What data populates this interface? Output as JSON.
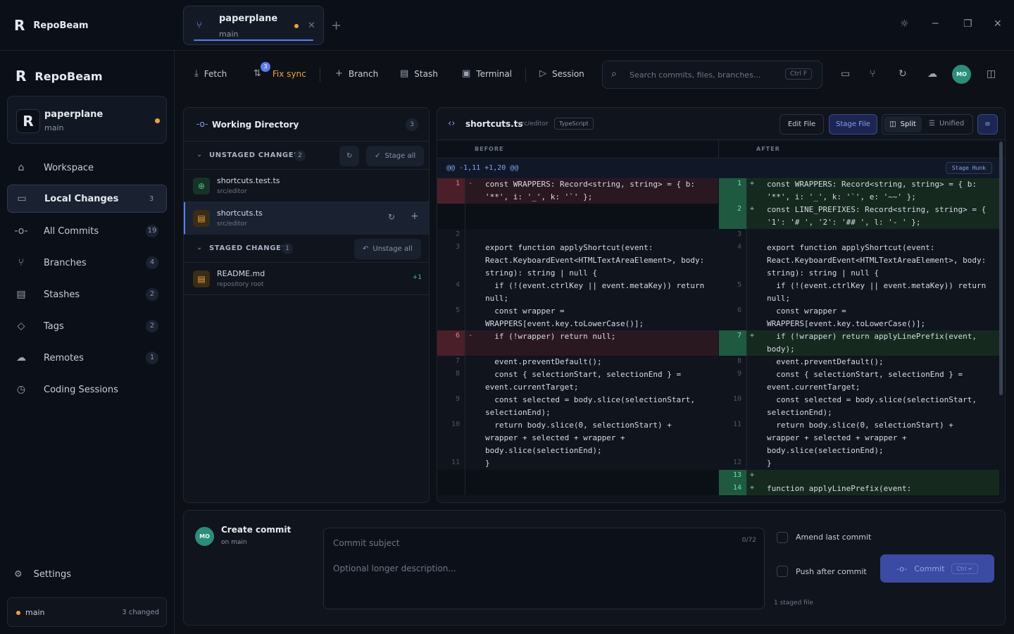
{
  "titlebar": {
    "app_name": "RepoBeam",
    "tab_title": "paperplane",
    "tab_branch": "main"
  },
  "sidebar": {
    "brand": "RepoBeam",
    "repo": {
      "name": "paperplane",
      "branch": "main"
    },
    "items": [
      {
        "label": "Workspace",
        "count": "",
        "icon": "home-icon"
      },
      {
        "label": "Local Changes",
        "count": "3",
        "icon": "inbox-icon"
      },
      {
        "label": "All Commits",
        "count": "19",
        "icon": "commit-icon"
      },
      {
        "label": "Branches",
        "count": "4",
        "icon": "branch-icon"
      },
      {
        "label": "Stashes",
        "count": "2",
        "icon": "archive-icon"
      },
      {
        "label": "Tags",
        "count": "2",
        "icon": "tag-icon"
      },
      {
        "label": "Remotes",
        "count": "1",
        "icon": "cloud-icon"
      },
      {
        "label": "Coding Sessions",
        "count": "",
        "icon": "clock-icon"
      }
    ],
    "settings": "Settings",
    "status": {
      "branch": "main",
      "changed": "3 changed"
    }
  },
  "toolbar": {
    "fetch": "Fetch",
    "fix_sync": "Fix sync",
    "fix_sync_badge": "3",
    "branch": "Branch",
    "stash": "Stash",
    "terminal": "Terminal",
    "session": "Session",
    "search_placeholder": "Search commits, files, branches...",
    "search_kbd": "Ctrl F",
    "avatar": "MO"
  },
  "working_directory": {
    "title": "Working Directory",
    "count": "3",
    "unstaged": {
      "label": "UNSTAGED CHANGES",
      "count": "2",
      "action": "Stage all",
      "files": [
        {
          "name": "shortcuts.test.ts",
          "path": "src/editor"
        },
        {
          "name": "shortcuts.ts",
          "path": "src/editor"
        }
      ]
    },
    "staged": {
      "label": "STAGED CHANGES",
      "count": "1",
      "action": "Unstage all",
      "files": [
        {
          "name": "README.md",
          "path": "repository root",
          "delta": "+1"
        }
      ]
    }
  },
  "diff": {
    "file": "shortcuts.ts",
    "path": "src/editor",
    "lang": "TypeScript",
    "edit": "Edit File",
    "stage": "Stage File",
    "split": "Split",
    "unified": "Unified",
    "before": "BEFORE",
    "after": "AFTER",
    "hunk": "@@ -1,11 +1,20 @@",
    "stage_hunk": "Stage Hunk",
    "left": [
      {
        "n": "1",
        "m": "-",
        "kind": "del",
        "lines": [
          "const WRAPPERS: Record<string, string> = { b:",
          "'**', i: '_', k: '`' };"
        ]
      },
      {
        "n": "",
        "m": "",
        "kind": "empty",
        "lines": [
          "",
          ""
        ]
      },
      {
        "n": "2",
        "m": "",
        "kind": "ctx",
        "lines": [
          ""
        ]
      },
      {
        "n": "3",
        "m": "",
        "kind": "ctx",
        "lines": [
          "export function applyShortcut(event:",
          "React.KeyboardEvent<HTMLTextAreaElement>, body:",
          "string): string | null {"
        ]
      },
      {
        "n": "4",
        "m": "",
        "kind": "ctx",
        "lines": [
          "  if (!(event.ctrlKey || event.metaKey)) return",
          "null;"
        ]
      },
      {
        "n": "5",
        "m": "",
        "kind": "ctx",
        "lines": [
          "  const wrapper =",
          "WRAPPERS[event.key.toLowerCase()];"
        ]
      },
      {
        "n": "6",
        "m": "-",
        "kind": "del",
        "lines": [
          "  if (!wrapper) return null;",
          ""
        ]
      },
      {
        "n": "7",
        "m": "",
        "kind": "ctx",
        "lines": [
          "  event.preventDefault();"
        ]
      },
      {
        "n": "8",
        "m": "",
        "kind": "ctx",
        "lines": [
          "  const { selectionStart, selectionEnd } =",
          "event.currentTarget;"
        ]
      },
      {
        "n": "9",
        "m": "",
        "kind": "ctx",
        "lines": [
          "  const selected = body.slice(selectionStart,",
          "selectionEnd);"
        ]
      },
      {
        "n": "10",
        "m": "",
        "kind": "ctx",
        "lines": [
          "  return body.slice(0, selectionStart) +",
          "wrapper + selected + wrapper +",
          "body.slice(selectionEnd);"
        ]
      },
      {
        "n": "11",
        "m": "",
        "kind": "ctx",
        "lines": [
          "}"
        ]
      },
      {
        "n": "",
        "m": "",
        "kind": "empty",
        "lines": [
          ""
        ]
      },
      {
        "n": "",
        "m": "",
        "kind": "empty",
        "lines": [
          ""
        ]
      }
    ],
    "right": [
      {
        "n": "1",
        "m": "+",
        "kind": "add",
        "lines": [
          "const WRAPPERS: Record<string, string> = { b:",
          "'**', i: '_', k: '`', e: '~~' };"
        ]
      },
      {
        "n": "2",
        "m": "+",
        "kind": "add",
        "lines": [
          "const LINE_PREFIXES: Record<string, string> = {",
          "'1': '# ', '2': '## ', l: '- ' };"
        ]
      },
      {
        "n": "3",
        "m": "",
        "kind": "ctx",
        "lines": [
          ""
        ]
      },
      {
        "n": "4",
        "m": "",
        "kind": "ctx",
        "lines": [
          "export function applyShortcut(event:",
          "React.KeyboardEvent<HTMLTextAreaElement>, body:",
          "string): string | null {"
        ]
      },
      {
        "n": "5",
        "m": "",
        "kind": "ctx",
        "lines": [
          "  if (!(event.ctrlKey || event.metaKey)) return",
          "null;"
        ]
      },
      {
        "n": "6",
        "m": "",
        "kind": "ctx",
        "lines": [
          "  const wrapper =",
          "WRAPPERS[event.key.toLowerCase()];"
        ]
      },
      {
        "n": "7",
        "m": "+",
        "kind": "add",
        "lines": [
          "  if (!wrapper) return applyLinePrefix(event,",
          "body);"
        ]
      },
      {
        "n": "8",
        "m": "",
        "kind": "ctx",
        "lines": [
          "  event.preventDefault();"
        ]
      },
      {
        "n": "9",
        "m": "",
        "kind": "ctx",
        "lines": [
          "  const { selectionStart, selectionEnd } =",
          "event.currentTarget;"
        ]
      },
      {
        "n": "10",
        "m": "",
        "kind": "ctx",
        "lines": [
          "  const selected = body.slice(selectionStart,",
          "selectionEnd);"
        ]
      },
      {
        "n": "11",
        "m": "",
        "kind": "ctx",
        "lines": [
          "  return body.slice(0, selectionStart) +",
          "wrapper + selected + wrapper +",
          "body.slice(selectionEnd);"
        ]
      },
      {
        "n": "12",
        "m": "",
        "kind": "ctx",
        "lines": [
          "}"
        ]
      },
      {
        "n": "13",
        "m": "+",
        "kind": "add",
        "lines": [
          ""
        ]
      },
      {
        "n": "14",
        "m": "+",
        "kind": "add",
        "lines": [
          "function applyLinePrefix(event:"
        ]
      }
    ]
  },
  "commit": {
    "avatar": "MO",
    "title": "Create commit",
    "subtitle": "on main",
    "subject_placeholder": "Commit subject",
    "counter": "0/72",
    "description_placeholder": "Optional longer description...",
    "amend": "Amend last commit",
    "push": "Push after commit",
    "staged_info": "1 staged file",
    "button": "Commit",
    "button_kbd": "Ctrl ↵"
  },
  "colors": {
    "accent": "#5b7cf0",
    "warning": "#f0a040",
    "added": "#1e3a2c",
    "removed": "#3a1d24"
  }
}
